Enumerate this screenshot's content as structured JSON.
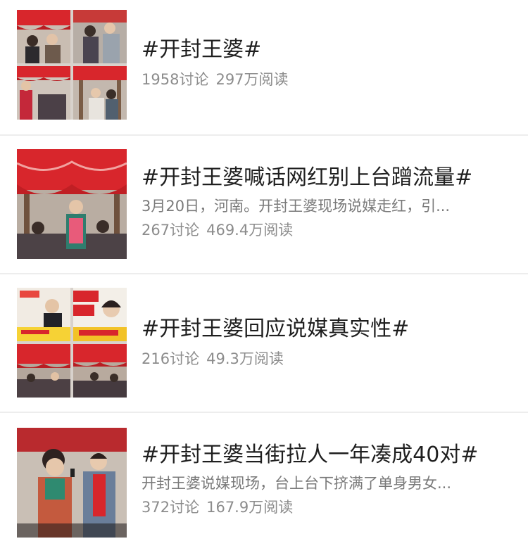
{
  "topics": [
    {
      "title": "#开封王婆#",
      "summary": "",
      "discussions": "1958讨论",
      "reads": "297万阅读",
      "thumbnail": "photo-grid-crowd-red-stage"
    },
    {
      "title": "#开封王婆喊话网红别上台蹭流量#",
      "summary": "3月20日，河南。开封王婆现场说媒走红，引...",
      "discussions": "267讨论",
      "reads": "469.4万阅读",
      "thumbnail": "photo-red-canopy-stage-crowd"
    },
    {
      "title": "#开封王婆回应说媒真实性#",
      "summary": "",
      "discussions": "216讨论",
      "reads": "49.3万阅读",
      "thumbnail": "photo-grid-news-thumbnails"
    },
    {
      "title": "#开封王婆当街拉人一年凑成40对#",
      "summary": "开封王婆说媒现场，台上台下挤满了单身男女...",
      "discussions": "372讨论",
      "reads": "167.9万阅读",
      "thumbnail": "photo-woman-with-microphone"
    }
  ],
  "colors": {
    "title": "#1f1f1f",
    "meta": "#8c8c8c",
    "separator": "#ededed",
    "stage_red": "#d8262c"
  }
}
